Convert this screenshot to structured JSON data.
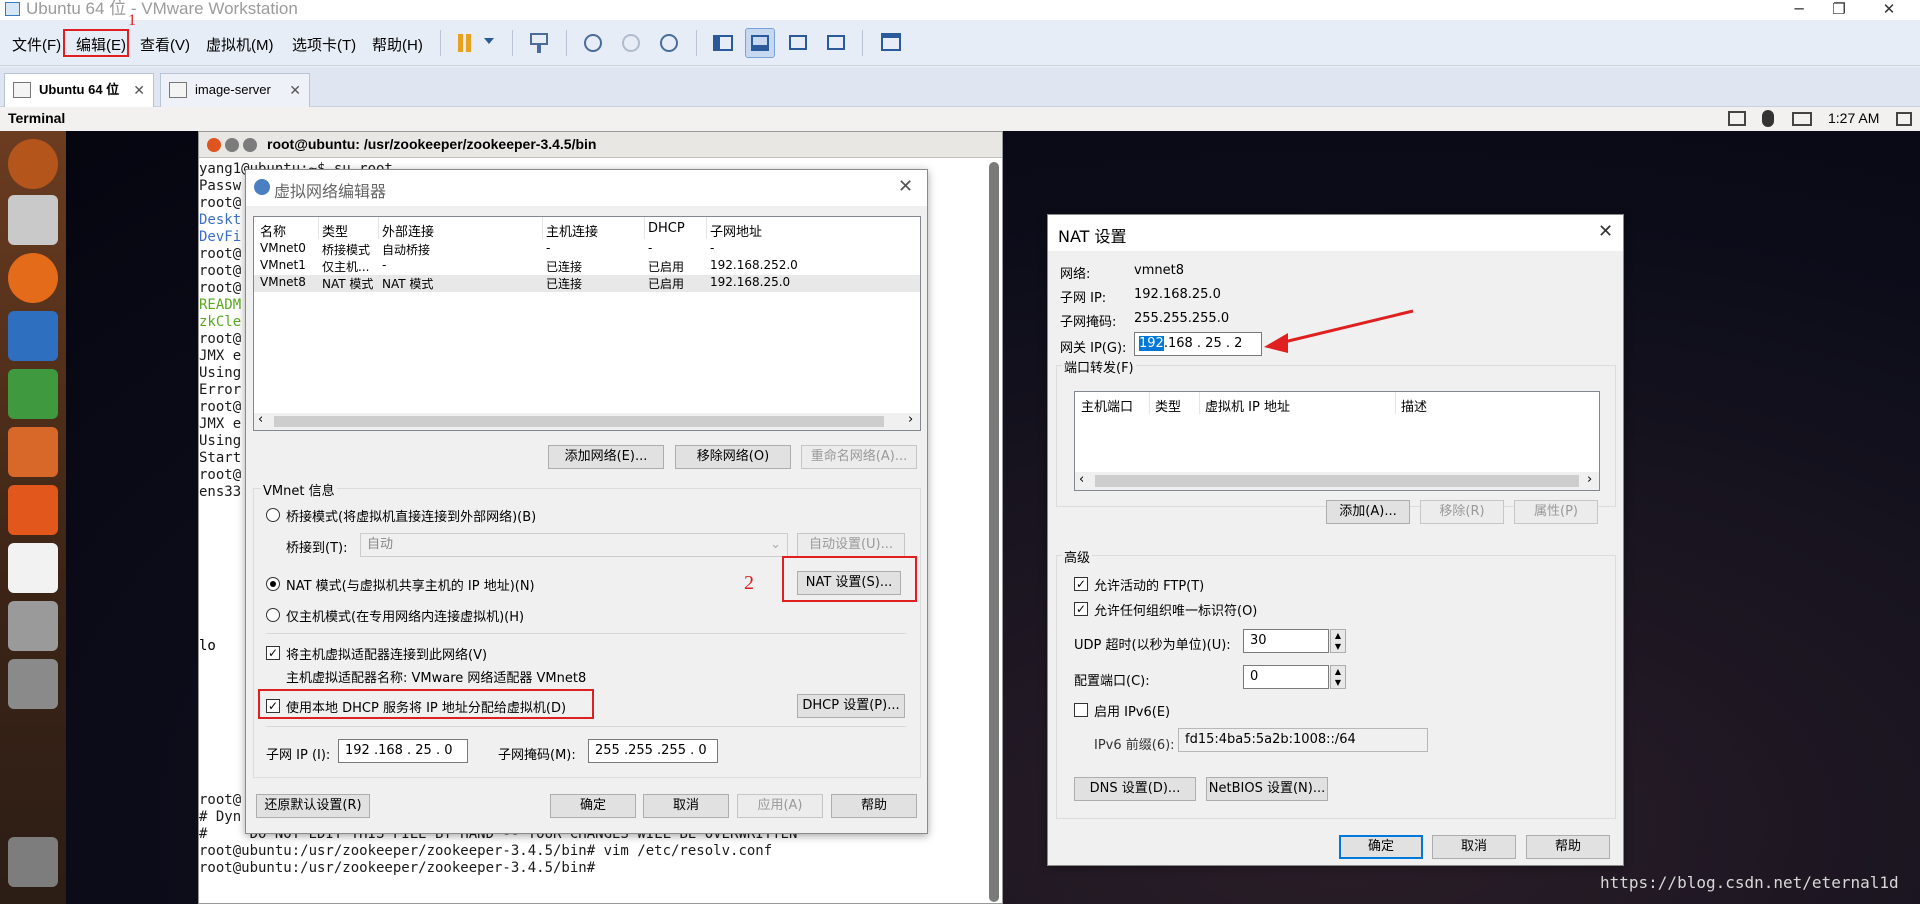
{
  "window": {
    "title": "Ubuntu 64 位 - VMware Workstation",
    "min": "─",
    "max": "❐",
    "close": "✕"
  },
  "menubar": {
    "items": [
      "文件(F)",
      "编辑(E)",
      "查看(V)",
      "虚拟机(M)",
      "选项卡(T)",
      "帮助(H)"
    ],
    "annotation_1": "1"
  },
  "tabs": [
    {
      "label": "Ubuntu 64 位"
    },
    {
      "label": "image-server"
    }
  ],
  "ubuntu_panel": {
    "app": "Terminal",
    "time": "1:27 AM"
  },
  "terminal": {
    "title": "root@ubuntu: /usr/zookeeper/zookeeper-3.4.5/bin",
    "lines_top": [
      {
        "text": "yang1@ubuntu:~$ su root",
        "color": "#1a1a1a",
        "prompt": "yang1@ubuntu"
      },
      {
        "text": "Passw",
        "color": "#1a1a1a"
      },
      {
        "text": "root@",
        "color": "#1a1a1a"
      },
      {
        "text": "Deskt",
        "color": "#3b6fc6"
      },
      {
        "text": "DevFi",
        "color": "#3b6fc6"
      },
      {
        "text": "root@",
        "color": "#1a1a1a"
      },
      {
        "text": "root@",
        "color": "#1a1a1a"
      },
      {
        "text": "root@",
        "color": "#1a1a1a"
      },
      {
        "text": "READM",
        "color": "#5aa820"
      },
      {
        "text": "zkCle",
        "color": "#5aa820"
      },
      {
        "text": "root@",
        "color": "#1a1a1a"
      },
      {
        "text": "JMX e",
        "color": "#1a1a1a"
      },
      {
        "text": "Using",
        "color": "#1a1a1a"
      },
      {
        "text": "Error",
        "color": "#1a1a1a"
      },
      {
        "text": "root@",
        "color": "#1a1a1a"
      },
      {
        "text": "JMX e",
        "color": "#1a1a1a"
      },
      {
        "text": "Using",
        "color": "#1a1a1a"
      },
      {
        "text": "Start",
        "color": "#1a1a1a"
      },
      {
        "text": "root@",
        "color": "#1a1a1a"
      },
      {
        "text": "ens33",
        "color": "#1a1a1a"
      }
    ],
    "lo": "lo",
    "lines_bottom": [
      "root@",
      "# Dyn",
      "#     DO NOT EDIT THIS FILE BY HAND -- YOUR CHANGES WILL BE OVERWRITTEN",
      "root@ubuntu:/usr/zookeeper/zookeeper-3.4.5/bin# vim /etc/resolv.conf",
      "root@ubuntu:/usr/zookeeper/zookeeper-3.4.5/bin# "
    ]
  },
  "vne": {
    "title": "虚拟网络编辑器",
    "columns": [
      "名称",
      "类型",
      "外部连接",
      "主机连接",
      "DHCP",
      "子网地址"
    ],
    "rows": [
      [
        "VMnet0",
        "桥接模式",
        "自动桥接",
        "-",
        "-",
        "-"
      ],
      [
        "VMnet1",
        "仅主机...",
        "-",
        "已连接",
        "已启用",
        "192.168.252.0"
      ],
      [
        "VMnet8",
        "NAT 模式",
        "NAT 模式",
        "已连接",
        "已启用",
        "192.168.25.0"
      ]
    ],
    "btn_add": "添加网络(E)...",
    "btn_remove": "移除网络(O)",
    "btn_rename": "重命名网络(A)...",
    "info_label": "VMnet 信息",
    "radio_bridge": "桥接模式(将虚拟机直接连接到外部网络)(B)",
    "bridge_to_label": "桥接到(T):",
    "bridge_to_value": "自动",
    "btn_auto": "自动设置(U)...",
    "radio_nat": "NAT 模式(与虚拟机共享主机的 IP 地址)(N)",
    "btn_nat": "NAT 设置(S)...",
    "annotation_2": "2",
    "radio_host": "仅主机模式(在专用网络内连接虚拟机)(H)",
    "chk_connect": "将主机虚拟适配器连接到此网络(V)",
    "adapter_name": "主机虚拟适配器名称: VMware 网络适配器 VMnet8",
    "chk_dhcp": "使用本地 DHCP 服务将 IP 地址分配给虚拟机(D)",
    "btn_dhcp": "DHCP 设置(P)...",
    "subnet_ip_label": "子网 IP (I):",
    "subnet_ip": "192 .168 . 25  .  0",
    "mask_label": "子网掩码(M):",
    "mask": "255 .255 .255 .  0",
    "btn_restore": "还原默认设置(R)",
    "btn_ok": "确定",
    "btn_cancel": "取消",
    "btn_apply": "应用(A)",
    "btn_help": "帮助"
  },
  "nat": {
    "title": "NAT 设置",
    "network_label": "网络:",
    "network": "vmnet8",
    "subnet_ip_label": "子网 IP:",
    "subnet_ip": "192.168.25.0",
    "mask_label": "子网掩码:",
    "mask": "255.255.255.0",
    "gateway_label": "网关 IP(G):",
    "gateway_sel": "192",
    "gateway_rest": ".168 . 25  .  2",
    "pf_label": "端口转发(F)",
    "pf_columns": [
      "主机端口",
      "类型",
      "虚拟机 IP 地址",
      "描述"
    ],
    "btn_add": "添加(A)...",
    "btn_remove": "移除(R)",
    "btn_props": "属性(P)",
    "adv_label": "高级",
    "chk_ftp": "允许活动的 FTP(T)",
    "chk_org": "允许任何组织唯一标识符(O)",
    "udp_label": "UDP 超时(以秒为单位)(U):",
    "udp_value": "30",
    "cfgport_label": "配置端口(C):",
    "cfgport_value": "0",
    "chk_ipv6": "启用 IPv6(E)",
    "ipv6_label": "IPv6 前缀(6):",
    "ipv6_value": "fd15:4ba5:5a2b:1008::/64",
    "btn_dns": "DNS 设置(D)...",
    "btn_netbios": "NetBIOS 设置(N)...",
    "btn_ok": "确定",
    "btn_cancel": "取消",
    "btn_help": "帮助"
  },
  "watermark": "https://blog.csdn.net/eternal1d",
  "colors": {
    "annotation_red": "#e02020",
    "selection": "#0078d7"
  }
}
